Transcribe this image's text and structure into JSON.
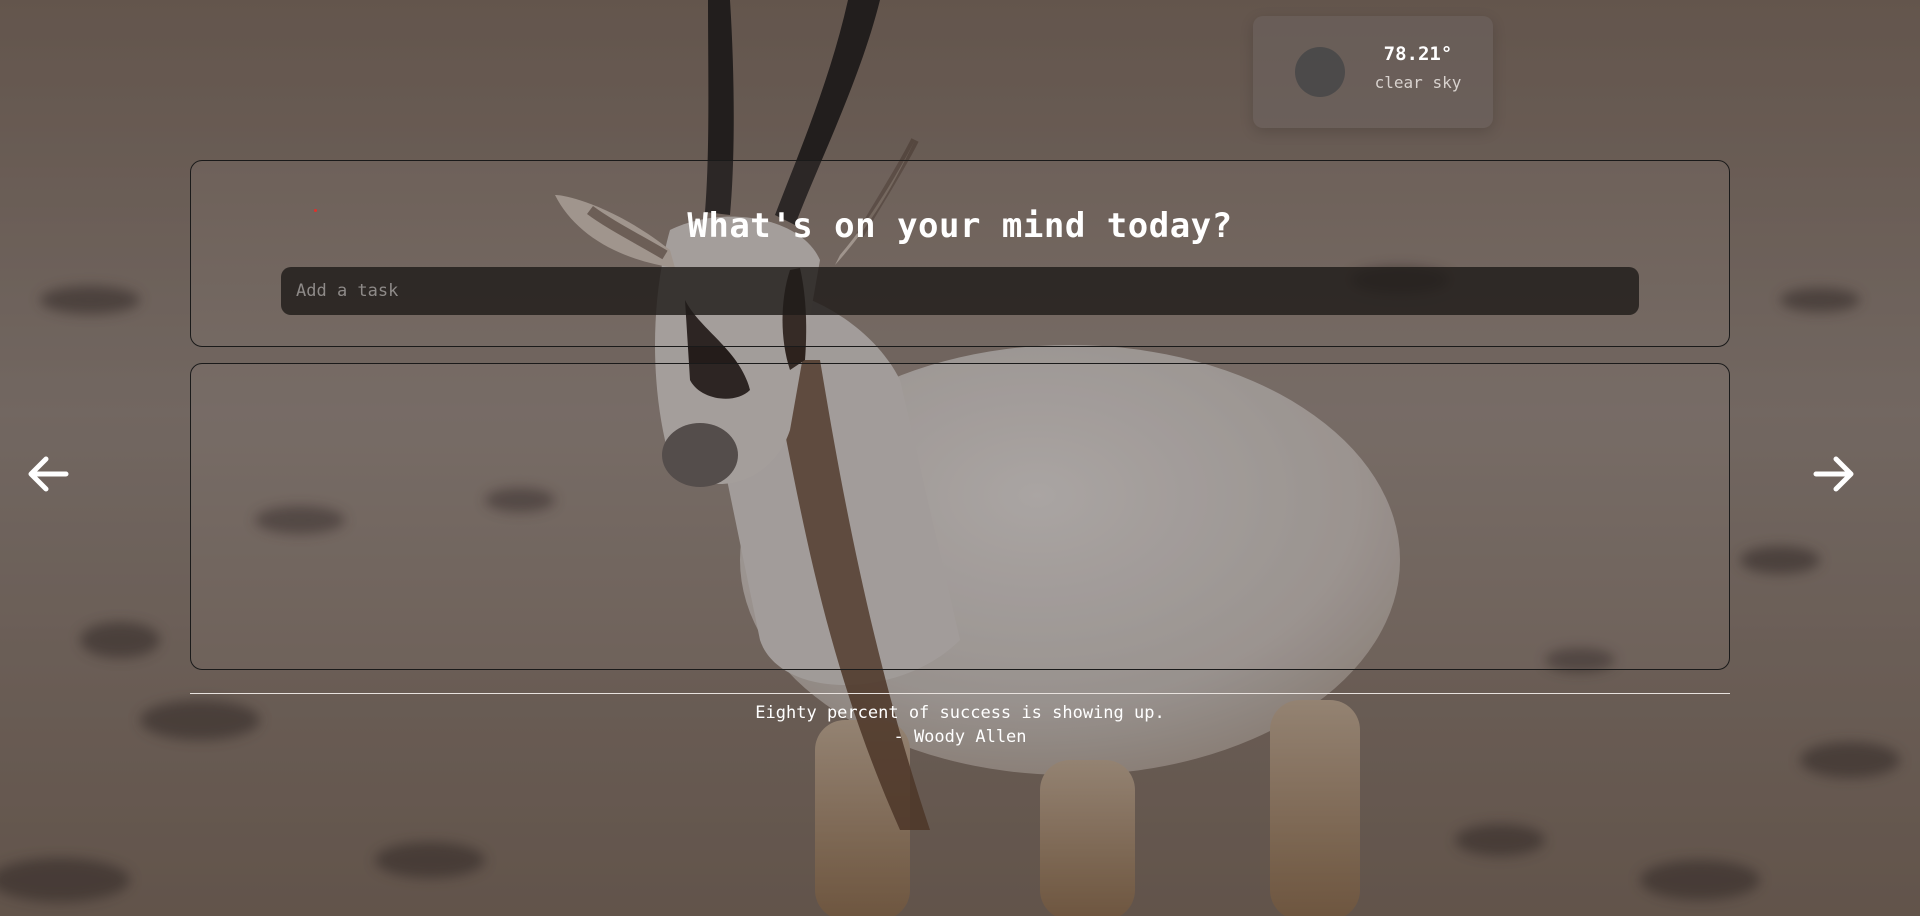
{
  "weather": {
    "temperature": "78.21°",
    "description": "clear sky",
    "icon": "weather-condition-icon"
  },
  "prompt": {
    "title": "What's on your mind today?"
  },
  "task_input": {
    "value": "",
    "placeholder": "Add a task"
  },
  "tasks": [],
  "navigation": {
    "previous_icon": "arrow-left-icon",
    "next_icon": "arrow-right-icon"
  },
  "quote": {
    "text": "Eighty percent of success is showing up.",
    "author": "- Woody Allen"
  },
  "colors": {
    "accent_dot": "#e0302a",
    "panel_border": "#1a1a1a",
    "input_background": "#201c1a"
  }
}
